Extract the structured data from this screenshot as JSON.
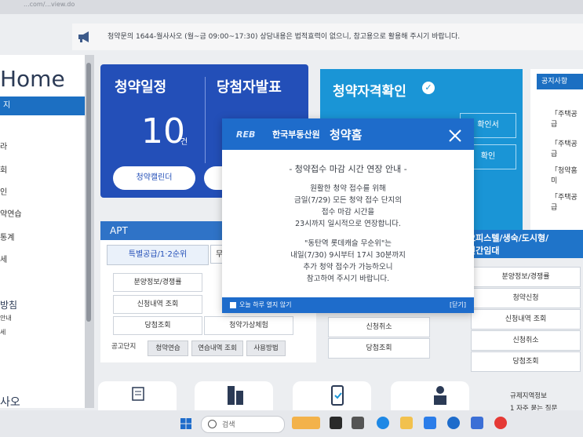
{
  "browser": {
    "url_fragment": "...com/...view.do"
  },
  "notice_bar": {
    "text": "청약문의 1644-월사사오 (월~금 09:00~17:30) 상담내용은 법적효력이 없으니, 참고용으로 활용해 주시기 바랍니다."
  },
  "left_nav": {
    "home_label": "Home",
    "active_item": "지",
    "items": [
      "라",
      "회",
      "인",
      "약연습",
      "통계",
      "세",
      "방침",
      "안내",
      "세",
      "사오"
    ]
  },
  "schedule_card": {
    "title": "청약일정",
    "count": "10",
    "count_unit": "건",
    "calendar_button": "청약캘린더"
  },
  "winner_card": {
    "title": "당첨자발표"
  },
  "eligibility_card": {
    "title": "청약자격확인",
    "buttons": [
      "확인서",
      "확인"
    ]
  },
  "announcements": {
    "header": "공지사항",
    "rows": [
      "「주택공급",
      "「주택공급",
      "「청약홈 미",
      "「주택공급"
    ]
  },
  "apt_section": {
    "header": "APT",
    "tab_active": "특별공급/1·2순위",
    "tab_other": "무",
    "cells": [
      "분양정보/경쟁률",
      "신청내역 조회",
      "당첨조회",
      "청약가상체험"
    ],
    "sub_label": "공고단지",
    "sub_buttons": [
      "청약연습",
      "연습내역 조회",
      "사용방법"
    ]
  },
  "middle_section": {
    "cells": [
      "신청취소",
      "당첨조회"
    ]
  },
  "officetel_section": {
    "header_line1": "오피스텔/생숙/도시형/",
    "header_line2": "민간임대",
    "cells": [
      "분양정보/경쟁률",
      "청약신청",
      "신청내역 조회",
      "신청취소",
      "당첨조회"
    ]
  },
  "right_links": {
    "items": [
      "규제지역정보",
      "1  자주 묻는 질문"
    ]
  },
  "modal": {
    "logo": "REB",
    "org_name": "한국부동산원",
    "app_name": "청약홈",
    "heading": "- 청약접수 마감 시간 연장 안내 -",
    "paragraph1": [
      "원활한 청약 접수를 위해",
      "금일(7/29) 모든 청약 접수 단지의",
      "접수 마감 시간을",
      "23시까지 일시적으로 연장합니다."
    ],
    "paragraph2": [
      "\"동탄역 롯데캐슬 무순위\"는",
      "내일(7/30) 9시부터 17시 30분까지",
      "추가 청약 접수가 가능하오니",
      "참고하여 주시기 바랍니다."
    ],
    "dont_show_today": "오늘 하루 열지 않기",
    "close_link": "[닫기]"
  },
  "taskbar": {
    "search_placeholder": "검색"
  },
  "colors": {
    "primary_blue": "#1e6ccb",
    "dark_blue": "#234fb8",
    "cyan": "#1a95d6"
  }
}
